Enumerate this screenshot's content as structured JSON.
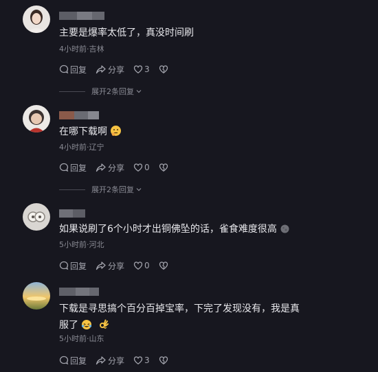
{
  "comments": [
    {
      "text": "主要是爆率太低了，真没时间刷",
      "meta": "4小时前·吉林",
      "reply_label": "回复",
      "share_label": "分享",
      "like_count": "3",
      "expand_label": "展开2条回复"
    },
    {
      "text": "在哪下载啊",
      "meta": "4小时前·辽宁",
      "reply_label": "回复",
      "share_label": "分享",
      "like_count": "0",
      "expand_label": "展开2条回复"
    },
    {
      "text": "如果说刷了6个小时才出铜佛坠的话，雀食难度很高",
      "meta": "5小时前·河北",
      "reply_label": "回复",
      "share_label": "分享",
      "like_count": "0"
    },
    {
      "text_line1": "下载是寻思搞个百分百掉宝率，下完了发现没有，我是真",
      "text_line2": "服了",
      "meta": "5小时前·山东",
      "reply_label": "回复",
      "share_label": "分享",
      "like_count": "3"
    }
  ],
  "colors": {
    "background": "#17171f",
    "text": "#e8e8ec",
    "muted": "#8a8b94"
  }
}
